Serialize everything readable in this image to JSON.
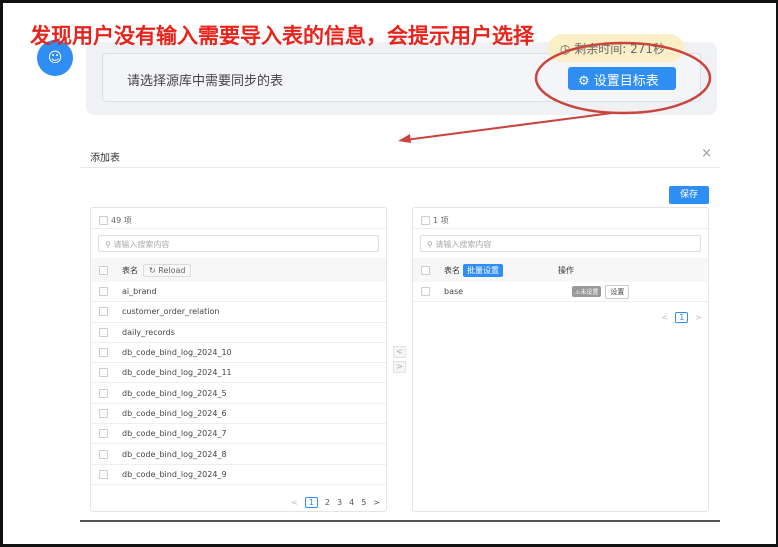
{
  "annotation": {
    "title": "发现用户没有输入需要导入表的信息，会提示用户选择",
    "color": "#e8231b"
  },
  "chat": {
    "prompt": "请选择源库中需要同步的表",
    "timer": "剩余时间: 271秒",
    "set_target_button": "设置目标表",
    "accent": "#2f8ef4"
  },
  "modal": {
    "title": "添加表",
    "close": "×",
    "save": "保存",
    "left": {
      "count": "49 项",
      "search_placeholder": "请输入搜索内容",
      "col_name": "表名",
      "reload": "Reload",
      "rows": [
        "ai_brand",
        "customer_order_relation",
        "daily_records",
        "db_code_bind_log_2024_10",
        "db_code_bind_log_2024_11",
        "db_code_bind_log_2024_5",
        "db_code_bind_log_2024_6",
        "db_code_bind_log_2024_7",
        "db_code_bind_log_2024_8",
        "db_code_bind_log_2024_9"
      ],
      "pages": [
        "1",
        "2",
        "3",
        "4",
        "5"
      ],
      "current_page": "1"
    },
    "transfer": {
      "left": "<",
      "right": ">"
    },
    "right": {
      "count": "1 项",
      "search_placeholder": "请输入搜索内容",
      "col_name": "表名",
      "batch": "批量设置",
      "col_op": "操作",
      "rows": [
        {
          "name": "base",
          "status": "⚠未设置",
          "action": "设置"
        }
      ],
      "current_page": "1"
    }
  }
}
